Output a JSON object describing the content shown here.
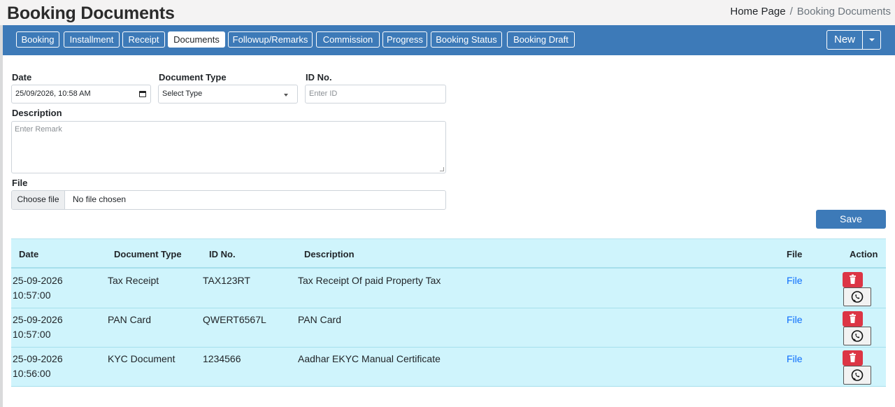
{
  "header": {
    "title": "Booking Documents",
    "breadcrumb_home": "Home Page",
    "breadcrumb_sep": "/",
    "breadcrumb_current": "Booking Documents"
  },
  "tabs": [
    "Booking",
    "Installment",
    "Receipt",
    "Documents",
    "Followup/Remarks",
    "Commission",
    "Progress",
    "Booking Status",
    "Booking Draft"
  ],
  "active_tab": "Documents",
  "new_button": "New",
  "form": {
    "date_label": "Date",
    "date_value": "25/09/2026, 10:58  AM",
    "doctype_label": "Document Type",
    "doctype_value": "Select Type",
    "id_label": "ID No.",
    "id_placeholder": "Enter ID",
    "desc_label": "Description",
    "desc_placeholder": "Enter Remark",
    "file_label": "File",
    "file_button": "Choose file",
    "file_status": "No file chosen",
    "save_button": "Save"
  },
  "table": {
    "columns": [
      "Date",
      "Document Type",
      "ID No.",
      "Description",
      "File",
      "Action"
    ],
    "rows": [
      {
        "date": "25-09-2026",
        "time": "10:57:00",
        "type": "Tax Receipt",
        "id": "TAX123RT",
        "desc": "Tax Receipt Of paid Property Tax",
        "file": "File"
      },
      {
        "date": "25-09-2026",
        "time": "10:57:00",
        "type": "PAN Card",
        "id": "QWERT6567L",
        "desc": "PAN Card",
        "file": "File"
      },
      {
        "date": "25-09-2026",
        "time": "10:56:00",
        "type": "KYC Document",
        "id": "1234566",
        "desc": "Aadhar EKYC Manual Certificate",
        "file": "File"
      }
    ]
  },
  "colors": {
    "primary": "#3d7ab8",
    "danger": "#dc3545",
    "table_bg": "#cff4fc",
    "link": "#0d6efd"
  }
}
